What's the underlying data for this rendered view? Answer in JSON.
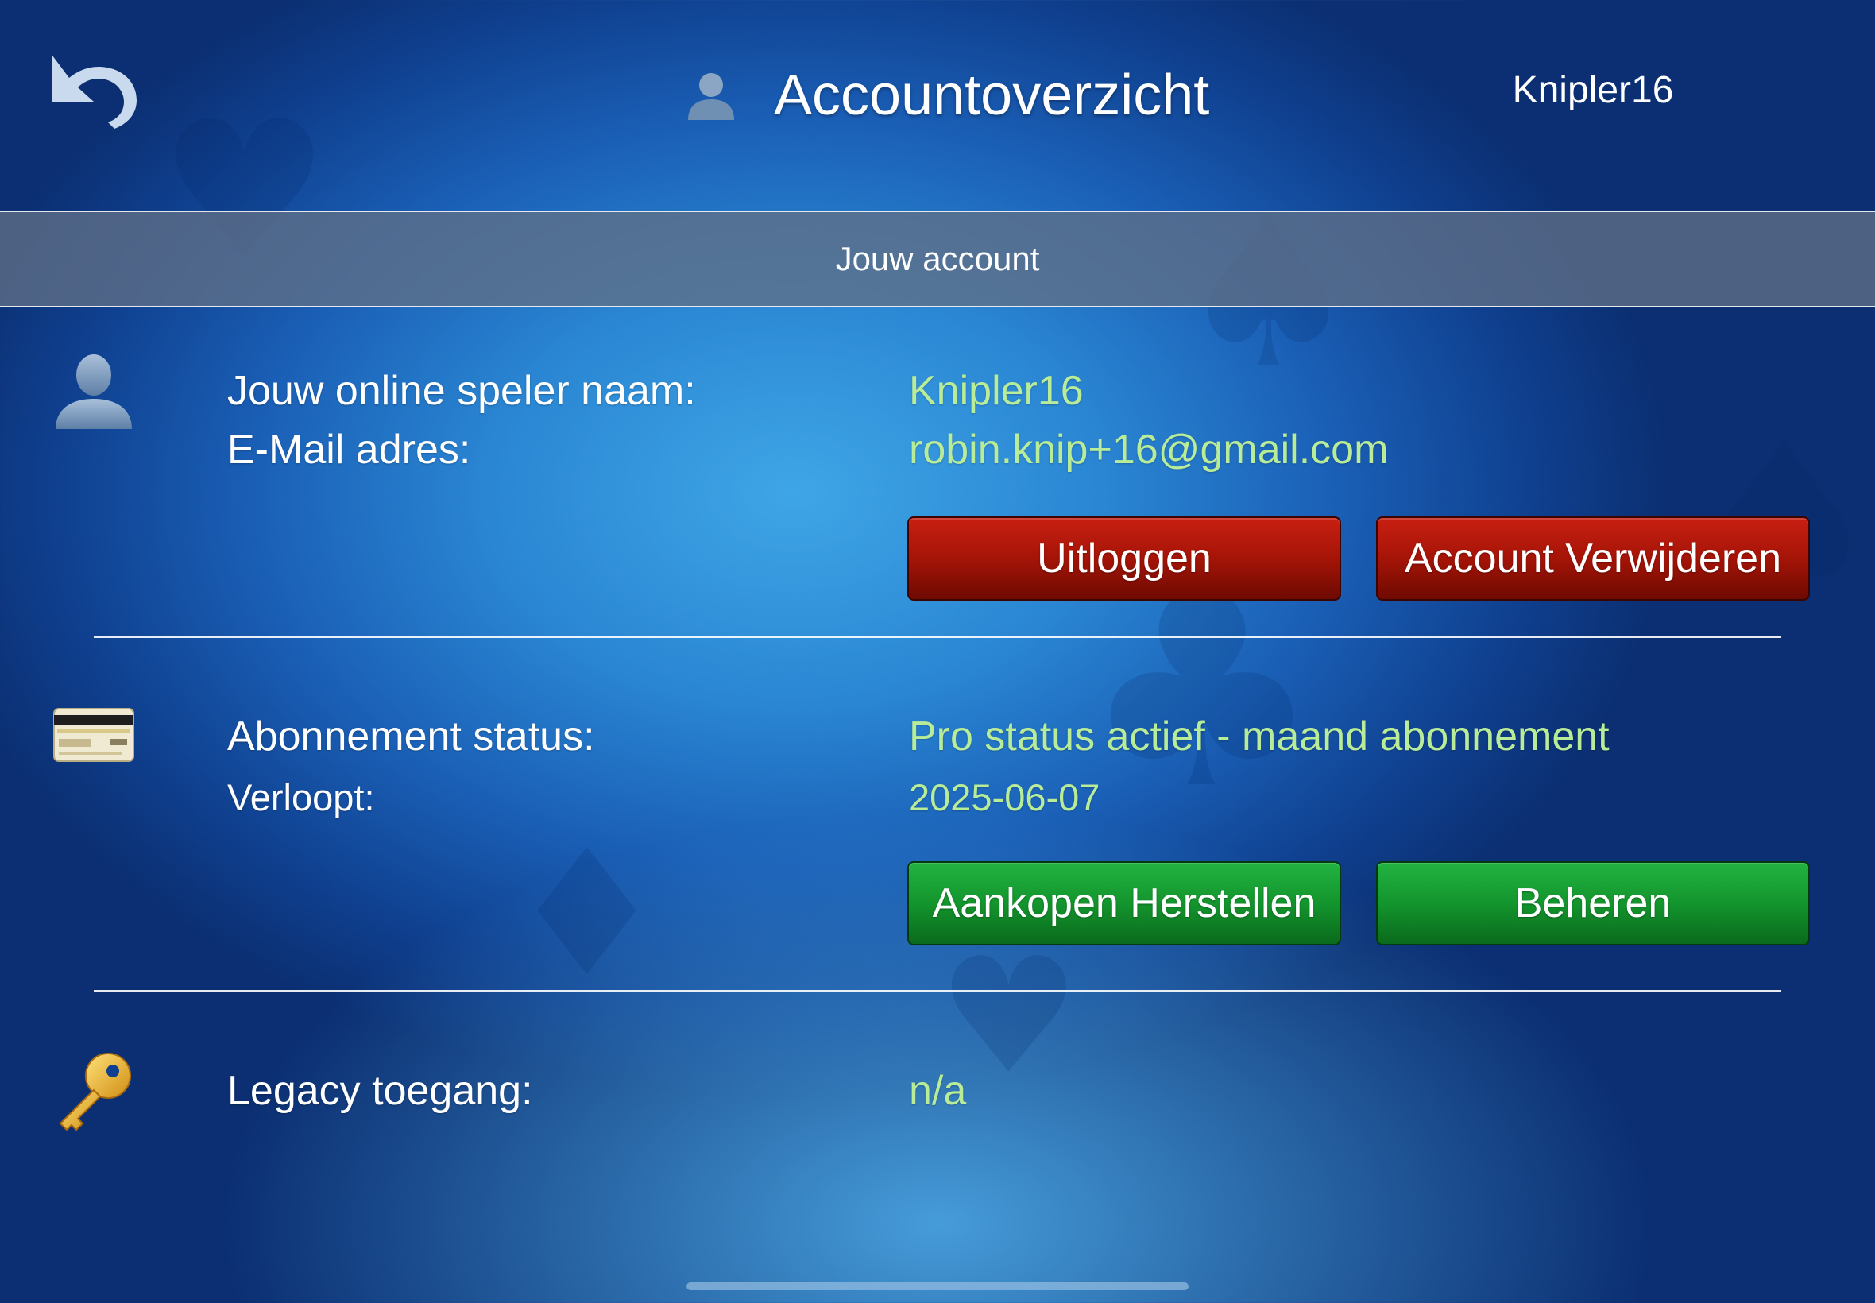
{
  "header": {
    "title": "Accountoverzicht",
    "username": "Knipler16"
  },
  "section": {
    "title": "Jouw account"
  },
  "account": {
    "player_name_label": "Jouw online speler naam:",
    "player_name_value": "Knipler16",
    "email_label": "E-Mail adres:",
    "email_value": "robin.knip+16@gmail.com",
    "logout_label": "Uitloggen",
    "delete_label": "Account Verwijderen"
  },
  "subscription": {
    "status_label": "Abonnement status:",
    "status_value": "Pro status actief - maand abonnement",
    "expires_label": "Verloopt:",
    "expires_value": "2025-06-07",
    "restore_label": "Aankopen Herstellen",
    "manage_label": "Beheren"
  },
  "legacy": {
    "label": "Legacy toegang:",
    "value": "n/a"
  },
  "icons": {
    "back": "undo-arrow-icon",
    "title": "user-icon",
    "account": "user-icon",
    "subscription": "credit-card-icon",
    "legacy": "key-icon"
  },
  "colors": {
    "value_text": "#b8ec98",
    "red_button": "#a51407",
    "green_button": "#13952d"
  }
}
